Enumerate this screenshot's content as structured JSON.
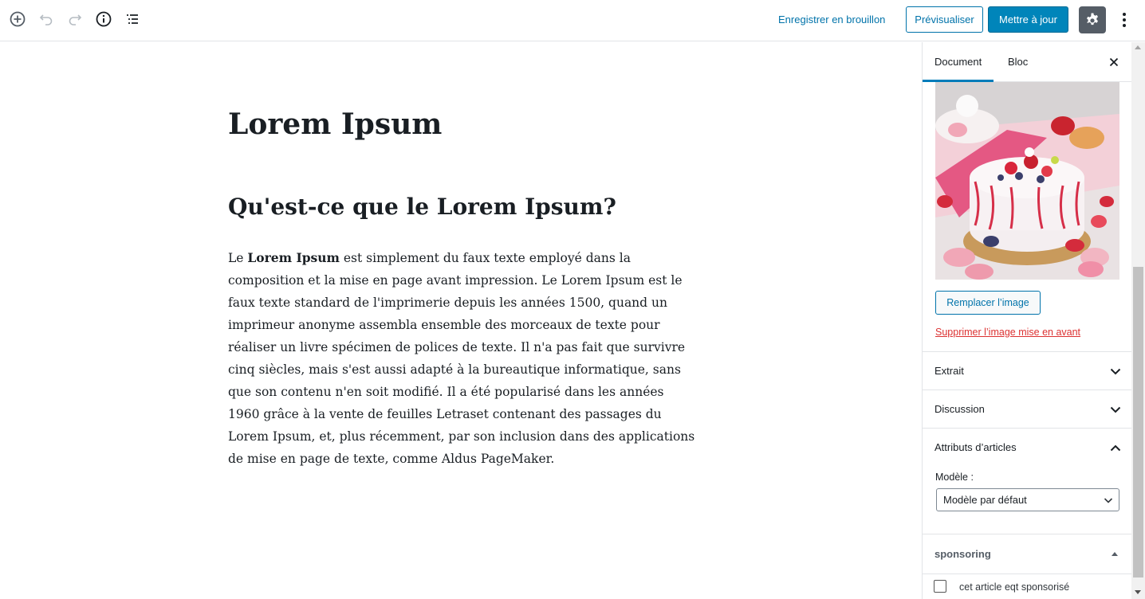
{
  "toolbar": {
    "save_draft_label": "Enregistrer en brouillon",
    "preview_label": "Prévisualiser",
    "update_label": "Mettre à jour"
  },
  "post": {
    "title": "Lorem Ipsum",
    "heading": "Qu'est-ce que le Lorem Ipsum?",
    "paragraph_prefix": "Le ",
    "paragraph_bold": "Lorem Ipsum",
    "paragraph_rest": " est simplement du faux texte employé dans la composition et la mise en page avant impression. Le Lorem Ipsum est le faux texte standard de l'imprimerie depuis les années 1500, quand un imprimeur anonyme assembla ensemble des morceaux de texte pour réaliser un livre spécimen de polices de texte. Il n'a pas fait que survivre cinq siècles, mais s'est aussi adapté à la bureautique informatique, sans que son contenu n'en soit modifié. Il a été popularisé dans les années 1960 grâce à la vente de feuilles Letraset contenant des passages du Lorem Ipsum, et, plus récemment, par son inclusion dans des applications de mise en page de texte, comme Aldus PageMaker."
  },
  "sidebar": {
    "tabs": [
      {
        "label": "Document",
        "active": true
      },
      {
        "label": "Bloc",
        "active": false
      }
    ],
    "featured_image": {
      "replace_label": "Remplacer l’image",
      "remove_label": "Supprimer l’image mise en avant"
    },
    "panels": {
      "excerpt": "Extrait",
      "discussion": "Discussion",
      "attributes": "Attributs d’articles",
      "sponsoring": "sponsoring"
    },
    "template": {
      "label": "Modèle :",
      "selected": "Modèle par défaut"
    },
    "sponsored_checkbox": {
      "label": "cet article eqt sponsorisé",
      "checked": false
    }
  },
  "colors": {
    "accent": "#0085ba",
    "link": "#0073aa",
    "danger": "#dc3232",
    "settings_bg": "#555d66"
  },
  "icons": {
    "add_block": "plus-circle-icon",
    "undo": "undo-icon",
    "redo": "redo-icon",
    "info": "info-icon",
    "outline": "list-icon",
    "settings": "gear-icon",
    "more": "more-vertical-icon",
    "close": "close-icon"
  }
}
